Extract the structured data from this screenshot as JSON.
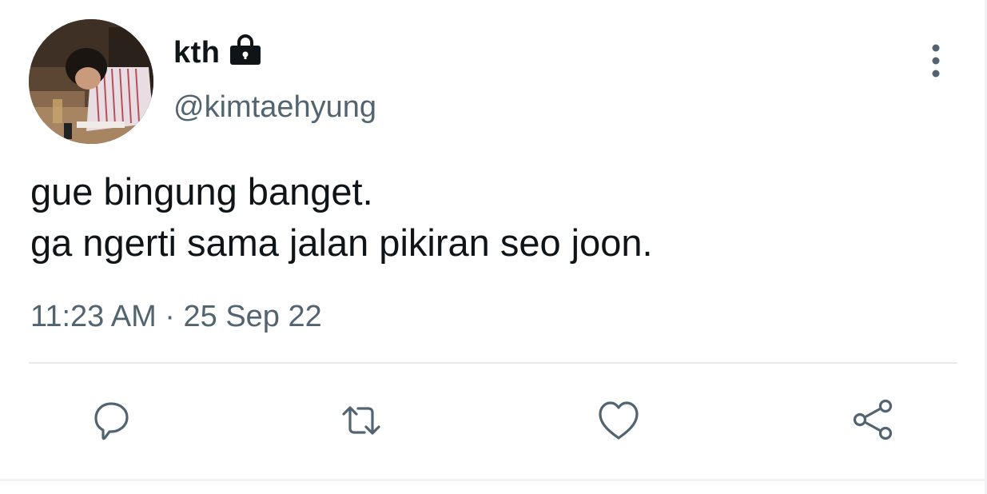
{
  "user": {
    "display_name": "kth",
    "handle": "@kimtaehyung",
    "protected_icon": "lock-icon",
    "avatar_icon": "profile-photo"
  },
  "tweet": {
    "lines": [
      "gue bingung banget.",
      "ga ngerti sama jalan pikiran seo joon."
    ],
    "timestamp": "11:23 AM · 25 Sep 22"
  },
  "actions": {
    "reply_icon": "comment-icon",
    "retweet_icon": "retweet-icon",
    "like_icon": "heart-icon",
    "share_icon": "share-icon",
    "more_icon": "more-vertical-icon"
  },
  "colors": {
    "text": "#0f1419",
    "secondary": "#536471",
    "divider": "#e7e9ea"
  }
}
